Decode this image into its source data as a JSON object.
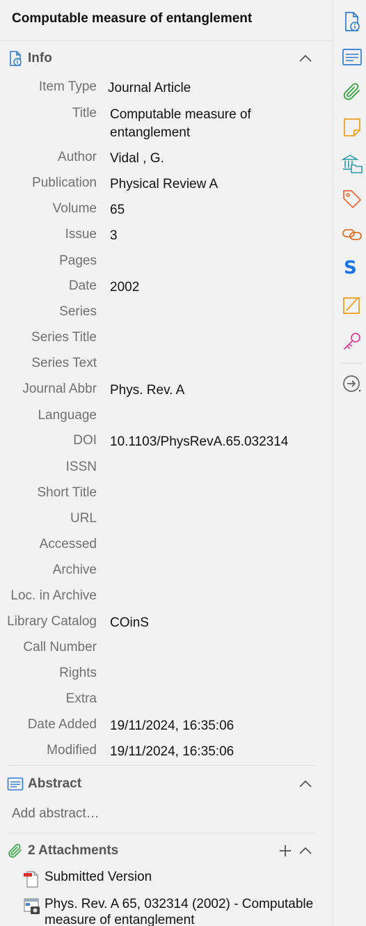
{
  "header": {
    "title": "Computable measure of entanglement"
  },
  "info": {
    "label": "Info",
    "fields": [
      {
        "label": "Item Type",
        "value": "Journal Article"
      },
      {
        "label": "Title",
        "value": "Computable measure of entanglement"
      },
      {
        "label": "Author",
        "value": "Vidal , G."
      },
      {
        "label": "Publication",
        "value": "Physical Review A"
      },
      {
        "label": "Volume",
        "value": "65"
      },
      {
        "label": "Issue",
        "value": "3"
      },
      {
        "label": "Pages",
        "value": ""
      },
      {
        "label": "Date",
        "value": "2002"
      },
      {
        "label": "Series",
        "value": ""
      },
      {
        "label": "Series Title",
        "value": ""
      },
      {
        "label": "Series Text",
        "value": ""
      },
      {
        "label": "Journal Abbr",
        "value": "Phys. Rev. A"
      },
      {
        "label": "Language",
        "value": ""
      },
      {
        "label": "DOI",
        "value": "10.1103/PhysRevA.65.032314"
      },
      {
        "label": "ISSN",
        "value": ""
      },
      {
        "label": "Short Title",
        "value": ""
      },
      {
        "label": "URL",
        "value": ""
      },
      {
        "label": "Accessed",
        "value": ""
      },
      {
        "label": "Archive",
        "value": ""
      },
      {
        "label": "Loc. in Archive",
        "value": ""
      },
      {
        "label": "Library Catalog",
        "value": "COinS"
      },
      {
        "label": "Call Number",
        "value": ""
      },
      {
        "label": "Rights",
        "value": ""
      },
      {
        "label": "Extra",
        "value": ""
      },
      {
        "label": "Date Added",
        "value": "19/11/2024, 16:35:06"
      },
      {
        "label": "Modified",
        "value": "19/11/2024, 16:35:06"
      }
    ]
  },
  "abstract": {
    "label": "Abstract",
    "placeholder": "Add abstract…"
  },
  "attachments": {
    "label": "2 Attachments",
    "items": [
      {
        "title": "Submitted Version",
        "icon": "pdf-icon"
      },
      {
        "title": "Phys. Rev. A 65, 032314 (2002) - Computable measure of entanglement",
        "icon": "snapshot-icon"
      }
    ]
  },
  "sidenav": {
    "icons": [
      "info-icon",
      "abstract-icon",
      "attachments-icon",
      "notes-icon",
      "libraries-collections-icon",
      "tags-icon",
      "related-icon",
      "scite-icon",
      "annotation-icon",
      "key-icon",
      "locate-icon"
    ]
  },
  "colors": {
    "accent": "#2f7cd0",
    "green": "#3aa548",
    "orange": "#f0a020",
    "teal": "#2a9aa6",
    "pink": "#e0409a",
    "background": "#f2f2f2"
  }
}
